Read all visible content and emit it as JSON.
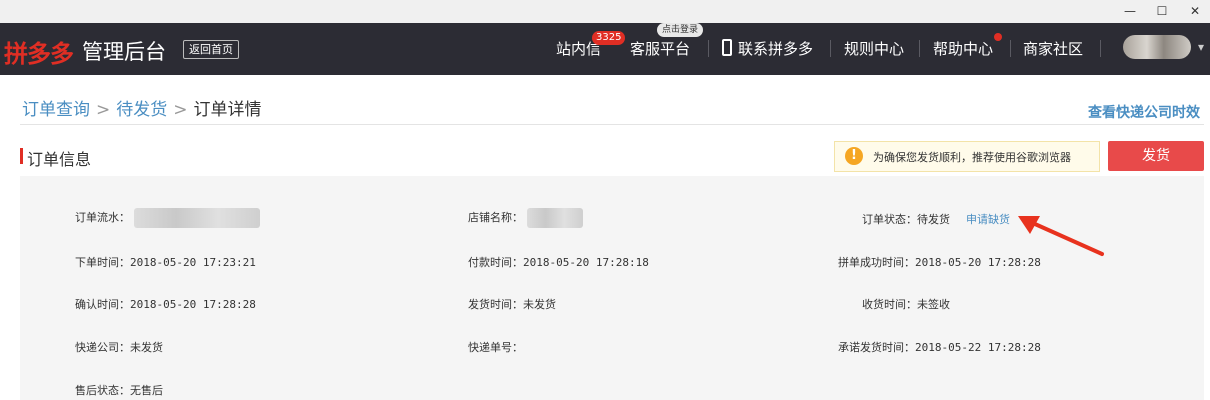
{
  "window": {
    "min": "—",
    "max": "☐",
    "close": "✕"
  },
  "header": {
    "logo": "拼多多",
    "subtitle": "管理后台",
    "back_home": "返回首页",
    "nav": {
      "messages": "站内信",
      "messages_badge": "3325",
      "service": "客服平台",
      "service_bubble": "点击登录",
      "contact": "联系拼多多",
      "rules": "规则中心",
      "help": "帮助中心",
      "community": "商家社区"
    }
  },
  "breadcrumb": {
    "item1": "订单查询",
    "item2": "待发货",
    "current": "订单详情",
    "sep": ">"
  },
  "express_link": "查看快递公司时效",
  "section": {
    "title": "订单信息",
    "notice": "为确保您发货顺利，推荐使用谷歌浏览器",
    "notice_icon": "!",
    "ship_button": "发货"
  },
  "order": {
    "serial_label": "订单流水：",
    "shop_label": "店铺名称：",
    "status_label": "订单状态：",
    "status_value": "待发货",
    "apply_link": "申请缺货",
    "order_time_label": "下单时间：",
    "order_time": "2018-05-20 17:23:21",
    "pay_time_label": "付款时间：",
    "pay_time": "2018-05-20 17:28:18",
    "group_time_label": "拼单成功时间：",
    "group_time": "2018-05-20 17:28:28",
    "confirm_time_label": "确认时间：",
    "confirm_time": "2018-05-20 17:28:28",
    "ship_time_label": "发货时间：",
    "ship_time": "未发货",
    "receive_time_label": "收货时间：",
    "receive_time": "未签收",
    "express_company_label": "快递公司：",
    "express_company": "未发货",
    "tracking_label": "快递单号：",
    "promise_time_label": "承诺发货时间：",
    "promise_time": "2018-05-22 17:28:28",
    "after_sale_label": "售后状态：",
    "after_sale": "无售后"
  },
  "colors": {
    "brand_red": "#e02e24",
    "link_blue": "#4a8ec2",
    "nav_bg": "#2c2c34"
  }
}
